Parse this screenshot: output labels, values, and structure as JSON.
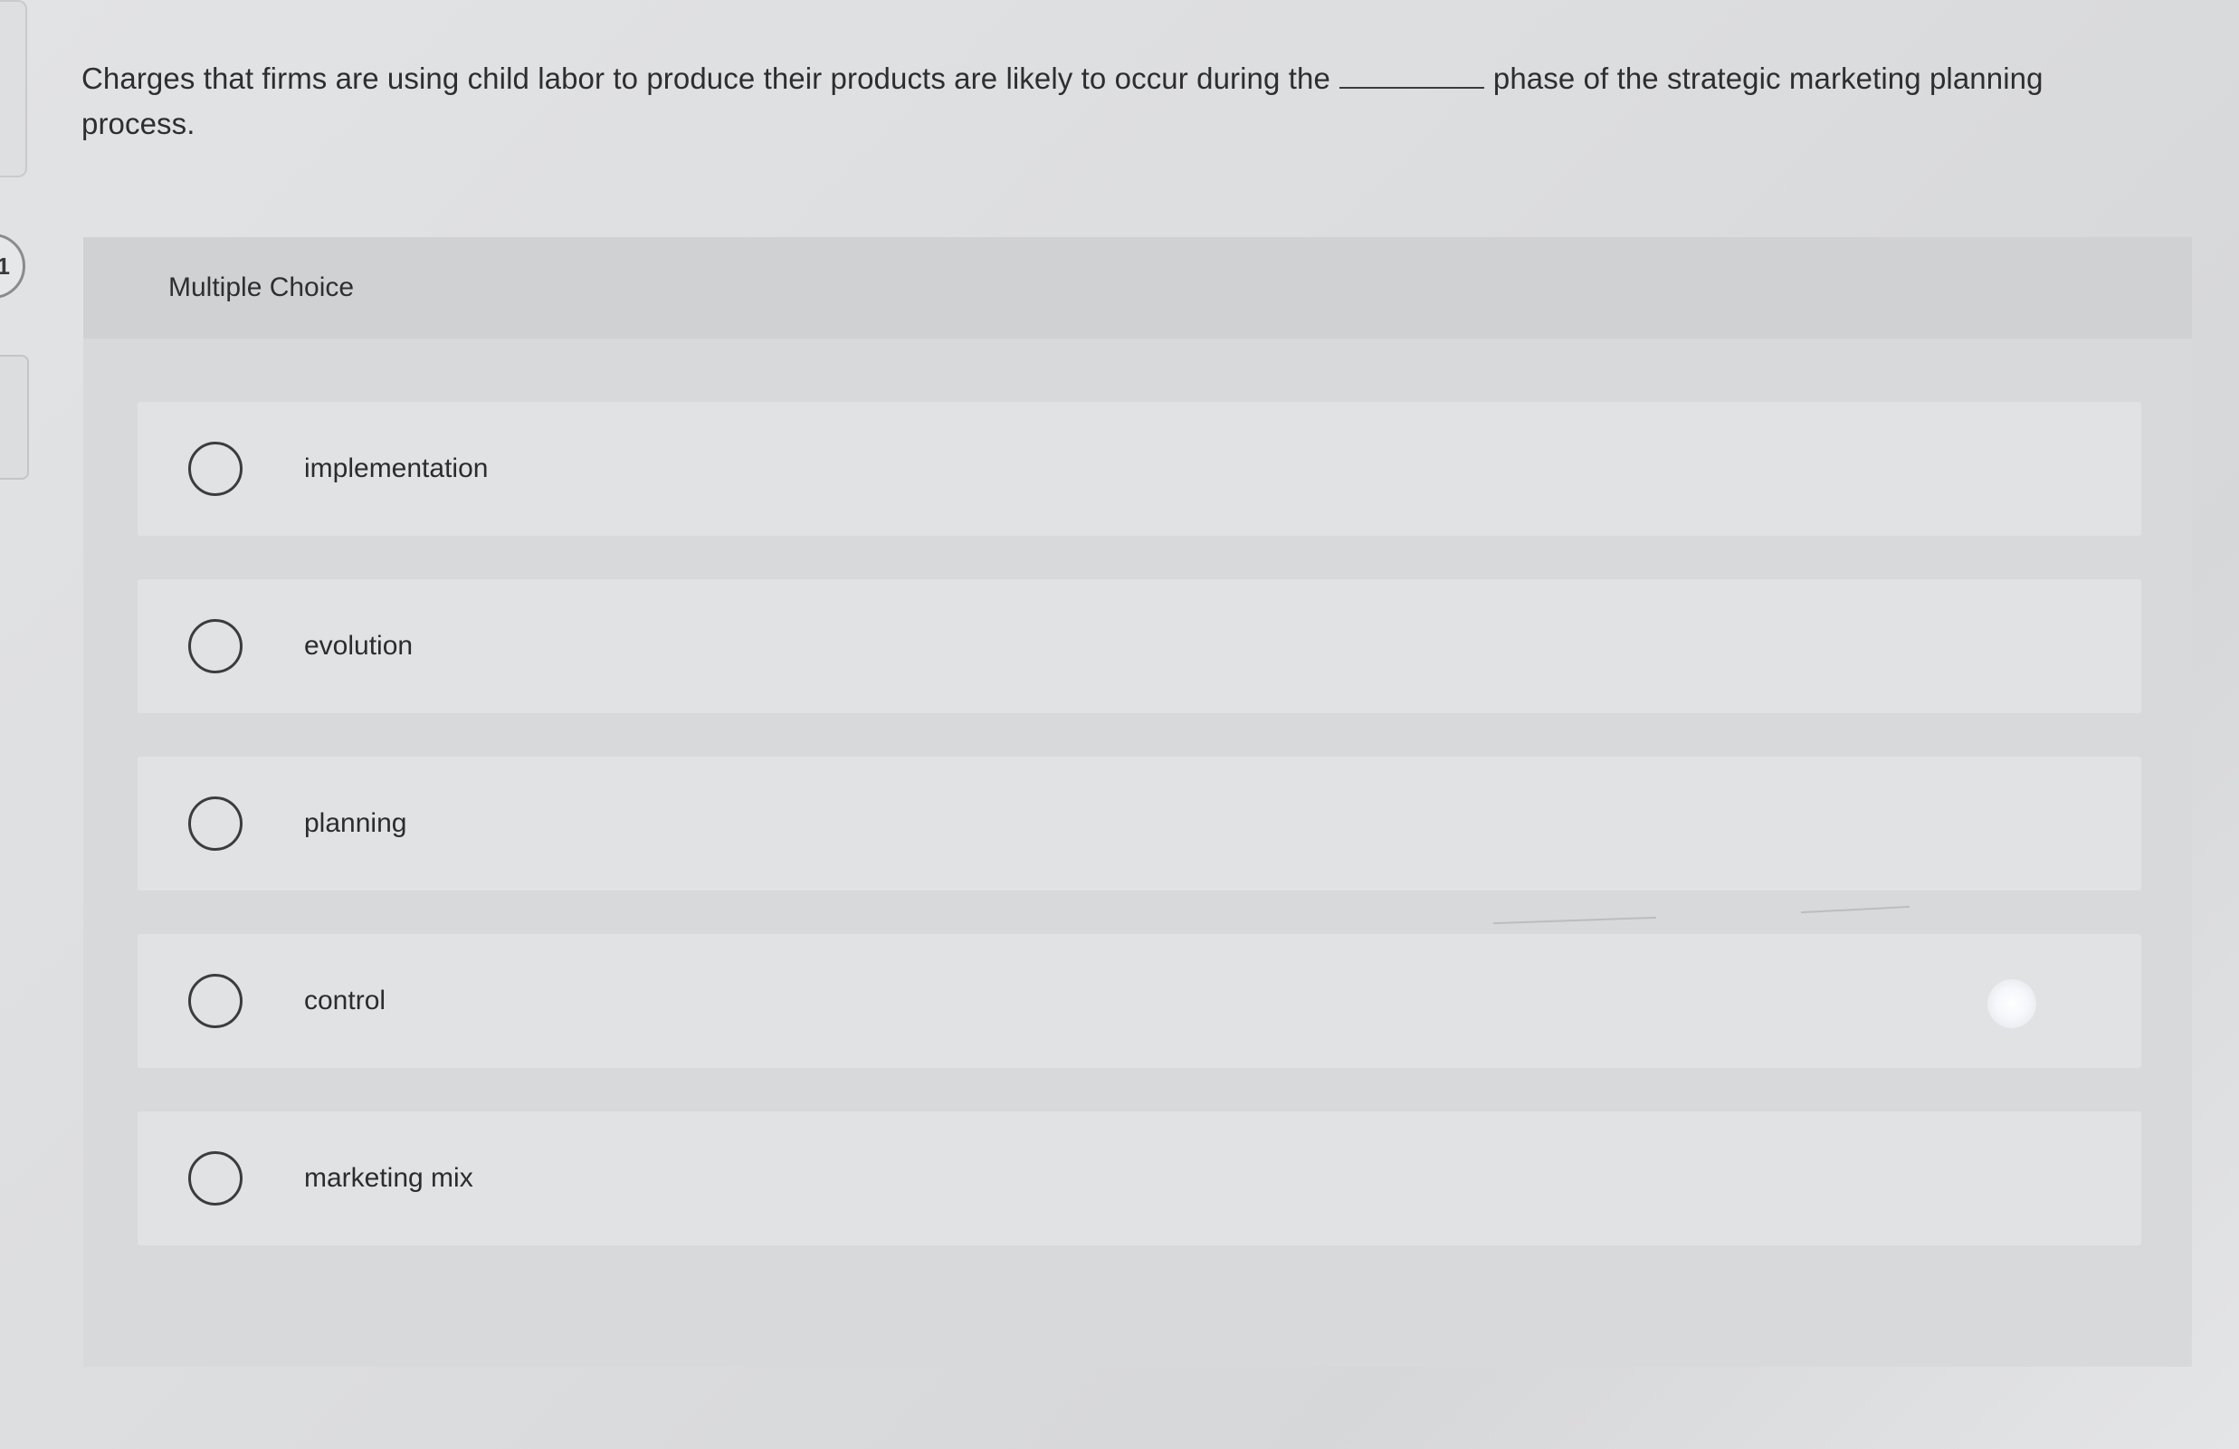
{
  "question": {
    "number": "1",
    "prompt_before_blank": "Charges that firms are using child labor to produce their products are likely to occur during the",
    "prompt_after_blank": "phase of the strategic marketing planning process."
  },
  "multiple_choice": {
    "header": "Multiple Choice",
    "options": [
      {
        "label": "implementation",
        "selected": false
      },
      {
        "label": "evolution",
        "selected": false
      },
      {
        "label": "planning",
        "selected": false
      },
      {
        "label": "control",
        "selected": false
      },
      {
        "label": "marketing mix",
        "selected": false
      }
    ]
  },
  "colors": {
    "background": "#dcdddf",
    "panel": "#d3d4d6",
    "option_row": "#e1e2e4",
    "text": "#2e2e2e",
    "radio_border": "#3c3c3e"
  }
}
